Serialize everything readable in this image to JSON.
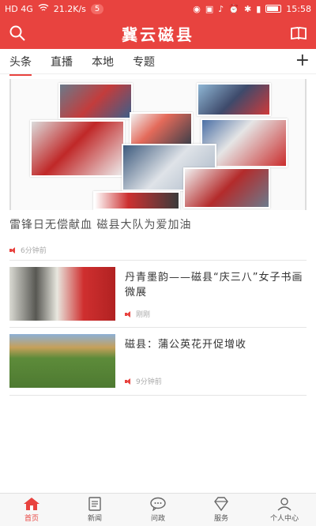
{
  "status": {
    "left_icons": "HD 4G",
    "speed": "21.2K/s",
    "badge": "5",
    "time": "15:58"
  },
  "app": {
    "title": "冀云磁县",
    "search_icon": "search-icon",
    "book_icon": "book-icon"
  },
  "tabs": [
    {
      "label": "头条"
    },
    {
      "label": "直播"
    },
    {
      "label": "本地"
    },
    {
      "label": "专题"
    }
  ],
  "feature": {
    "headline": "雷锋日无偿献血 磁县大队为爱加油",
    "time": "6分钟前"
  },
  "articles": [
    {
      "title": "丹青墨韵——磁县“庆三八”女子书画微展",
      "time": "刚刚"
    },
    {
      "title": "磁县：蒲公英花开促增收",
      "time": "9分钟前"
    }
  ],
  "nav": [
    {
      "label": "首页"
    },
    {
      "label": "新闻"
    },
    {
      "label": "问政"
    },
    {
      "label": "服务"
    },
    {
      "label": "个人中心"
    }
  ],
  "colors": {
    "accent": "#e8433f"
  }
}
